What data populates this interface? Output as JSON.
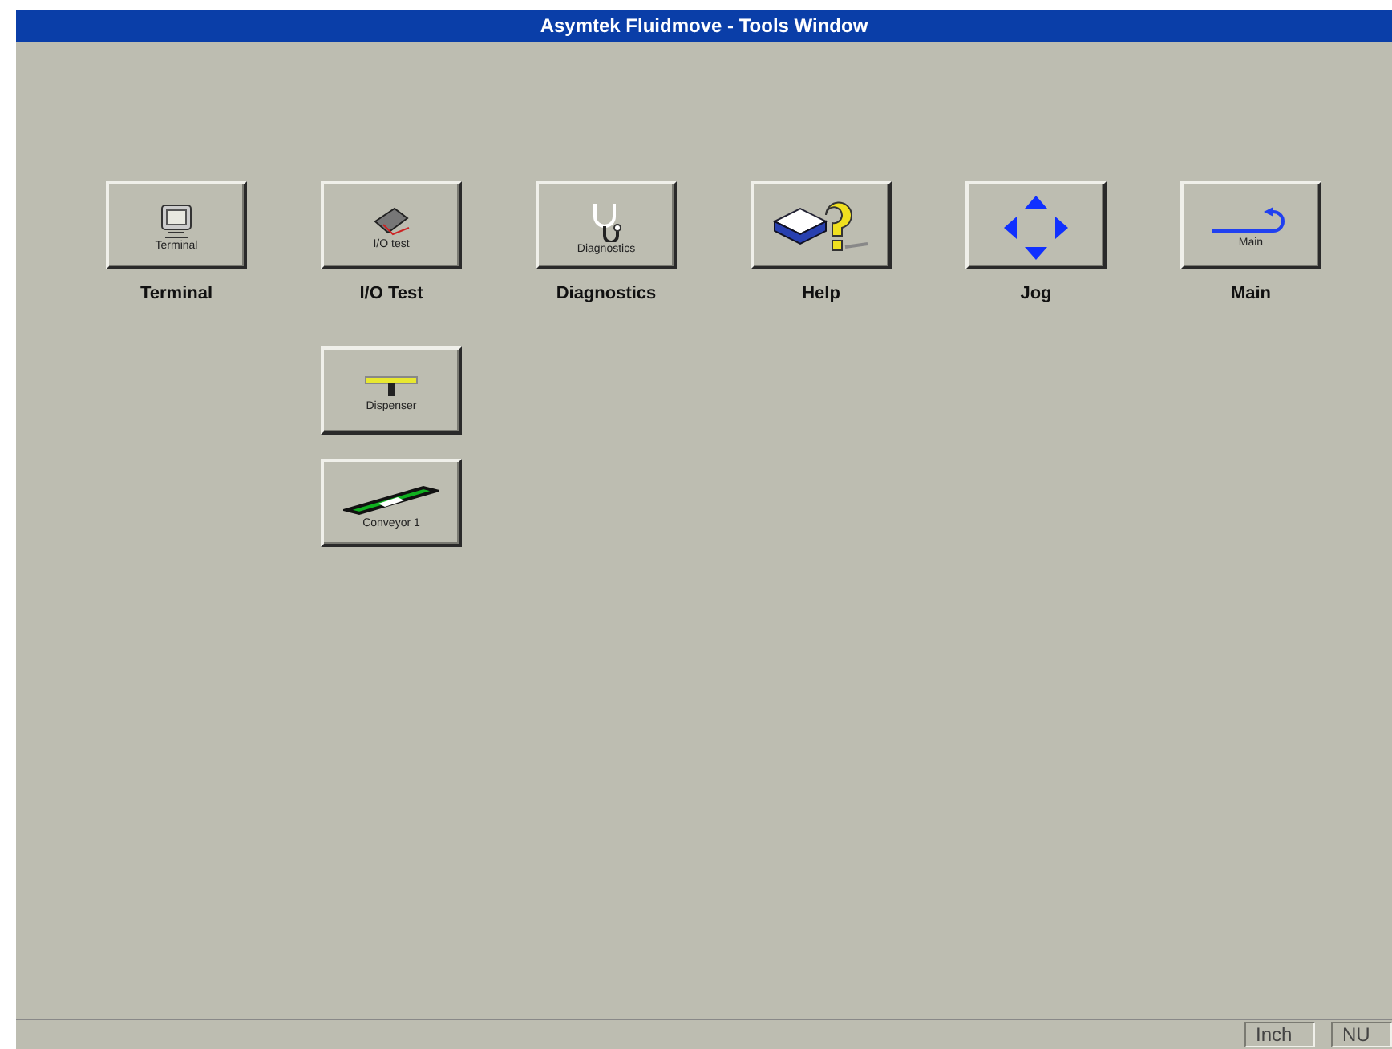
{
  "window": {
    "title": "Asymtek Fluidmove - Tools Window"
  },
  "tool_columns": [
    {
      "label": "Terminal",
      "tool": {
        "kind": "terminal",
        "caption": "Terminal"
      }
    },
    {
      "label": "I/O Test",
      "tool": {
        "kind": "io",
        "caption": "I/O test"
      },
      "more": [
        {
          "kind": "dispenser",
          "caption": "Dispenser"
        },
        {
          "kind": "conveyor",
          "caption": "Conveyor 1"
        }
      ]
    },
    {
      "label": "Diagnostics",
      "tool": {
        "kind": "diagnostics",
        "caption": "Diagnostics"
      }
    },
    {
      "label": "Help",
      "tool": {
        "kind": "help"
      }
    },
    {
      "label": "Jog",
      "tool": {
        "kind": "jog"
      }
    },
    {
      "label": "Main",
      "tool": {
        "kind": "main",
        "caption": "Main"
      }
    }
  ],
  "status_bar": {
    "panels": [
      "Inch",
      "NU"
    ]
  }
}
